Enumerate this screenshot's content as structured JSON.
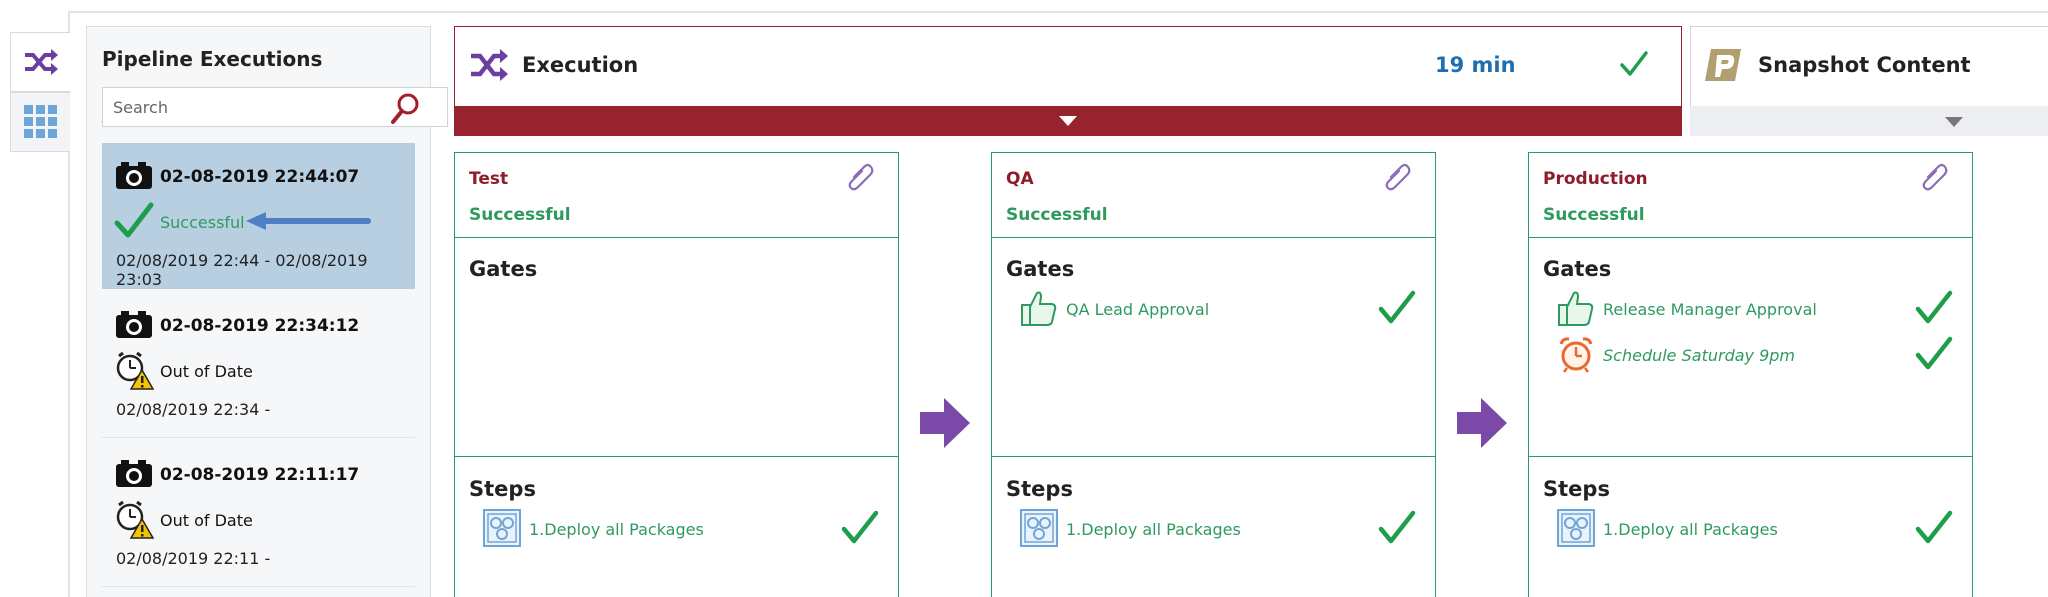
{
  "nav": {
    "tabs": [
      {
        "name": "pipeline-tab",
        "icon": "shuffle-icon",
        "active": true
      },
      {
        "name": "grid-tab",
        "icon": "grid-icon",
        "active": false
      }
    ]
  },
  "executions": {
    "title": "Pipeline Executions",
    "search_placeholder": "Search",
    "runs": [
      {
        "id": "02-08-2019 22:44:07",
        "status": "Successful",
        "range": "02/08/2019 22:44  -  02/08/2019 23:03",
        "selected": true
      },
      {
        "id": "02-08-2019 22:34:12",
        "status": "Out of Date",
        "range": "02/08/2019 22:34  -",
        "selected": false
      },
      {
        "id": "02-08-2019 22:11:17",
        "status": "Out of Date",
        "range": "02/08/2019 22:11  -",
        "selected": false
      }
    ]
  },
  "execution_header": {
    "title": "Execution",
    "duration": "19 min"
  },
  "snapshot_header": {
    "title": "Snapshot Content"
  },
  "stages": [
    {
      "name": "Test",
      "status": "Successful",
      "gates_title": "Gates",
      "gates": [],
      "steps_title": "Steps",
      "steps": [
        {
          "label": "1.Deploy all Packages"
        }
      ]
    },
    {
      "name": "QA",
      "status": "Successful",
      "gates_title": "Gates",
      "gates": [
        {
          "label": "QA Lead Approval",
          "icon": "thumbs-up-icon"
        }
      ],
      "steps_title": "Steps",
      "steps": [
        {
          "label": "1.Deploy all Packages"
        }
      ]
    },
    {
      "name": "Production",
      "status": "Successful",
      "gates_title": "Gates",
      "gates": [
        {
          "label": "Release Manager Approval",
          "icon": "thumbs-up-icon"
        },
        {
          "label": "Schedule Saturday 9pm",
          "icon": "alarm-clock-icon"
        }
      ],
      "steps_title": "Steps",
      "steps": [
        {
          "label": "1.Deploy all Packages"
        }
      ]
    }
  ],
  "colors": {
    "brand_purple": "#6b3fa0",
    "header_red": "#99222f",
    "success_green": "#2e9a5f",
    "stage_border": "#2a9a68",
    "duration_blue": "#1f6fb0",
    "selected_bg": "#b8cfe2"
  }
}
